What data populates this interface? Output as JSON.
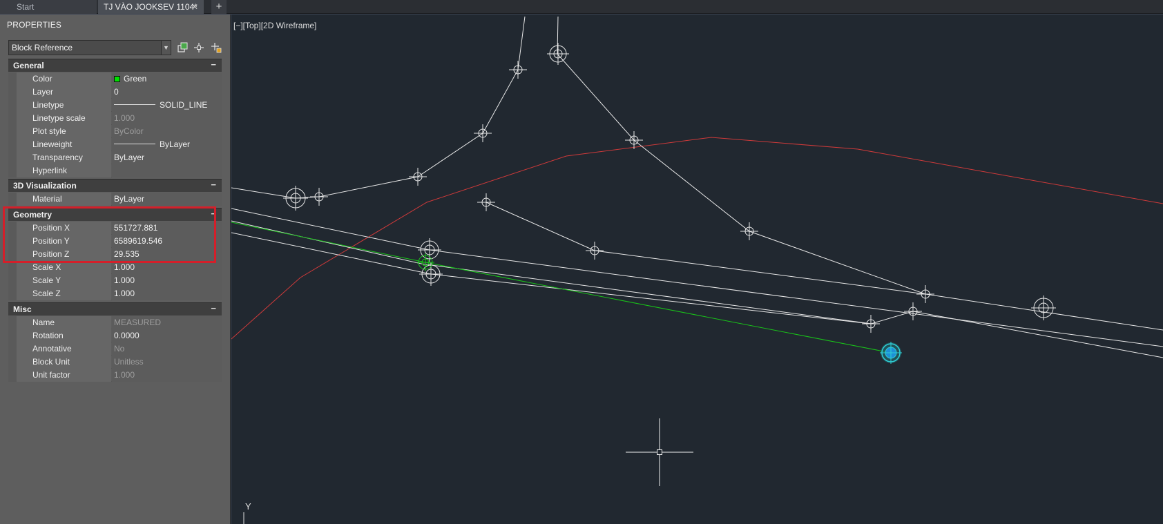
{
  "tabs": [
    {
      "label": "Start"
    },
    {
      "label": "TJ VÀO JOOKSEV 1104*",
      "close": "✕"
    },
    {
      "label": "+"
    }
  ],
  "palette": {
    "title": "PROPERTIES",
    "object_type": "Block Reference",
    "sections": {
      "general": {
        "title": "General",
        "toggle": "−"
      },
      "viz": {
        "title": "3D Visualization",
        "toggle": "−"
      },
      "geometry": {
        "title": "Geometry",
        "toggle": "−"
      },
      "misc": {
        "title": "Misc",
        "toggle": "−"
      }
    },
    "general": [
      {
        "label": "Color",
        "value": "Green"
      },
      {
        "label": "Layer",
        "value": "0"
      },
      {
        "label": "Linetype",
        "value": "SOLID_LINE"
      },
      {
        "label": "Linetype scale",
        "value": "1.000"
      },
      {
        "label": "Plot style",
        "value": "ByColor"
      },
      {
        "label": "Lineweight",
        "value": "ByLayer"
      },
      {
        "label": "Transparency",
        "value": "ByLayer"
      },
      {
        "label": "Hyperlink",
        "value": ""
      }
    ],
    "viz": [
      {
        "label": "Material",
        "value": "ByLayer"
      }
    ],
    "geometry": [
      {
        "label": "Position X",
        "value": "551727.881"
      },
      {
        "label": "Position Y",
        "value": "6589619.546"
      },
      {
        "label": "Position Z",
        "value": "29.535"
      },
      {
        "label": "Scale X",
        "value": "1.000"
      },
      {
        "label": "Scale Y",
        "value": "1.000"
      },
      {
        "label": "Scale Z",
        "value": "1.000"
      }
    ],
    "misc": [
      {
        "label": "Name",
        "value": "MEASURED"
      },
      {
        "label": "Rotation",
        "value": "0.0000"
      },
      {
        "label": "Annotative",
        "value": "No"
      },
      {
        "label": "Block Unit",
        "value": "Unitless"
      },
      {
        "label": "Unit factor",
        "value": "1.000"
      }
    ]
  },
  "viewport": {
    "label": "[−][Top][2D Wireframe]",
    "ucs_axis": "Y"
  },
  "colors": {
    "drawing_bg": "#212830",
    "red_line": "#d03a3a",
    "green_line": "#19c419",
    "selected_grip": "#1e90d6",
    "highlight_box": "#d41f2a"
  }
}
